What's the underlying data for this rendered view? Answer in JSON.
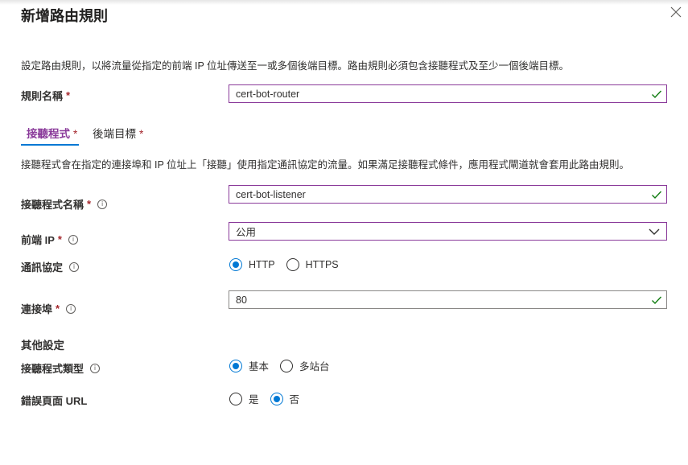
{
  "dialog": {
    "title": "新增路由規則",
    "description": "設定路由規則，以將流量從指定的前端 IP 位址傳送至一或多個後端目標。路由規則必須包含接聽程式及至少一個後端目標。"
  },
  "rule_name": {
    "label": "規則名稱",
    "required": "*",
    "value": "cert-bot-router"
  },
  "tabs": [
    {
      "label": "接聽程式",
      "required": "*"
    },
    {
      "label": "後端目標",
      "required": "*"
    }
  ],
  "listener_description": "接聽程式會在指定的連接埠和 IP 位址上「接聽」使用指定通訊協定的流量。如果滿足接聽程式條件，應用程式閘道就會套用此路由規則。",
  "listener_name": {
    "label": "接聽程式名稱",
    "required": "*",
    "value": "cert-bot-listener"
  },
  "frontend_ip": {
    "label": "前端 IP",
    "required": "*",
    "value": "公用"
  },
  "protocol": {
    "label": "通訊協定",
    "options": [
      "HTTP",
      "HTTPS"
    ],
    "selected": "HTTP"
  },
  "port": {
    "label": "連接埠",
    "required": "*",
    "value": "80"
  },
  "other_settings": {
    "title": "其他設定"
  },
  "listener_type": {
    "label": "接聽程式類型",
    "options": [
      "基本",
      "多站台"
    ],
    "selected": "基本"
  },
  "error_page": {
    "label": "錯誤頁面 URL",
    "options": [
      "是",
      "否"
    ],
    "selected": "否"
  },
  "colors": {
    "accent": "#0078d4",
    "field_border": "#8a3a9a",
    "valid_check": "#107c10",
    "required": "#a4262c"
  },
  "icons": {
    "close": "close-icon",
    "valid": "checkmark-icon",
    "dropdown": "chevron-down-icon",
    "info": "info-icon"
  }
}
